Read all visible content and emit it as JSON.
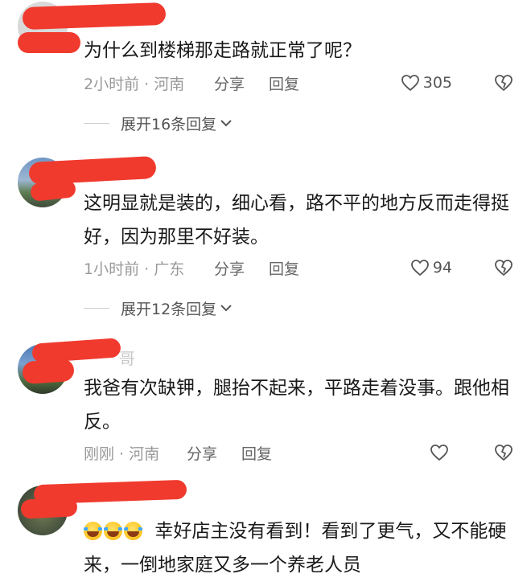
{
  "comments": [
    {
      "text": "为什么到楼梯那走路就正常了呢？",
      "time_location": "2小时前 · 河南",
      "share_label": "分享",
      "reply_label": "回复",
      "like_count": "305",
      "expand_label": "展开16条回复"
    },
    {
      "text": "这明显就是装的，细心看，路不平的地方反而走得挺好，因为那里不好装。",
      "time_location": "1小时前 · 广东",
      "share_label": "分享",
      "reply_label": "回复",
      "like_count": "94",
      "expand_label": "展开12条回复"
    },
    {
      "text": "我爸有次缺钾，腿抬不起来，平路走着没事。跟他相反。",
      "time_location": "刚刚 · 河南",
      "share_label": "分享",
      "reply_label": "回复",
      "like_count": "",
      "visible_name_fragment": "哥"
    },
    {
      "emoji": "laughing-crying-emoji",
      "emoji_count": 3,
      "text": "幸好店主没有看到！看到了更气，又不能硬来，一倒地家庭又多一个养老人员"
    }
  ],
  "colors": {
    "redaction": "#f03a2e",
    "meta_text": "#999999",
    "body_text": "#1a1a1a"
  }
}
